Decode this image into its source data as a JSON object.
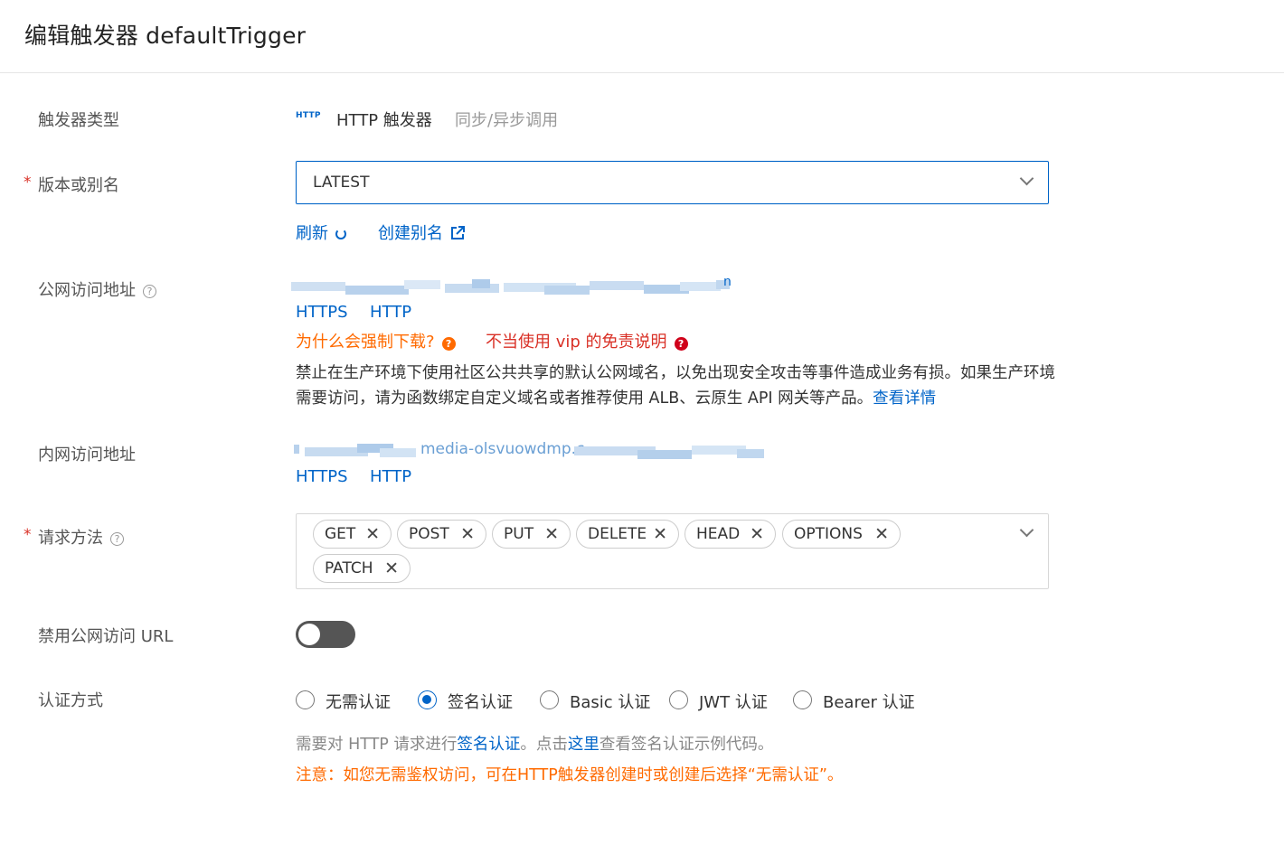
{
  "header": {
    "title": "编辑触发器 defaultTrigger"
  },
  "trigger_type": {
    "label": "触发器类型",
    "badge": "HTTP",
    "type_text": "HTTP 触发器",
    "mode_text": "同步/异步调用"
  },
  "version": {
    "label": "版本或别名",
    "required_mark": "*",
    "selected": "LATEST",
    "refresh_label": "刷新",
    "create_alias_label": "创建别名"
  },
  "public_url": {
    "label": "公网访问地址",
    "help": "?",
    "blurred_tail": "n",
    "https_label": "HTTPS",
    "http_label": "HTTP",
    "why_download": "为什么会强制下载?",
    "vip_disclaimer": "不当使用 vip 的免责说明",
    "notice_text": "禁止在生产环境下使用社区公共共享的默认公网域名，以免出现安全攻击等事件造成业务有损。如果生产环境需要访问，请为函数绑定自定义域名或者推荐使用 ALB、云原生 API 网关等产品。",
    "notice_link": "查看详情"
  },
  "internal_url": {
    "label": "内网访问地址",
    "blurred_text": "media-olsvuowdmp.c",
    "https_label": "HTTPS",
    "http_label": "HTTP"
  },
  "methods": {
    "label": "请求方法",
    "required_mark": "*",
    "help": "?",
    "tags": [
      "GET",
      "POST",
      "PUT",
      "DELETE",
      "HEAD",
      "OPTIONS",
      "PATCH"
    ]
  },
  "disable_public": {
    "label": "禁用公网访问 URL",
    "enabled": false
  },
  "auth": {
    "label": "认证方式",
    "options": [
      "无需认证",
      "签名认证",
      "Basic 认证",
      "JWT 认证",
      "Bearer 认证"
    ],
    "selected": "签名认证",
    "hint_prefix": "需要对 HTTP 请求进行",
    "hint_link1": "签名认证",
    "hint_mid": "。点击",
    "hint_link2": "这里",
    "hint_suffix": "查看签名认证示例代码。",
    "note": "注意：如您无需鉴权访问，可在HTTP触发器创建时或创建后选择“无需认证”。"
  },
  "colors": {
    "primary": "#0064c8",
    "warning": "#ff6a00",
    "danger": "#d93026",
    "switch_off": "#555555"
  }
}
